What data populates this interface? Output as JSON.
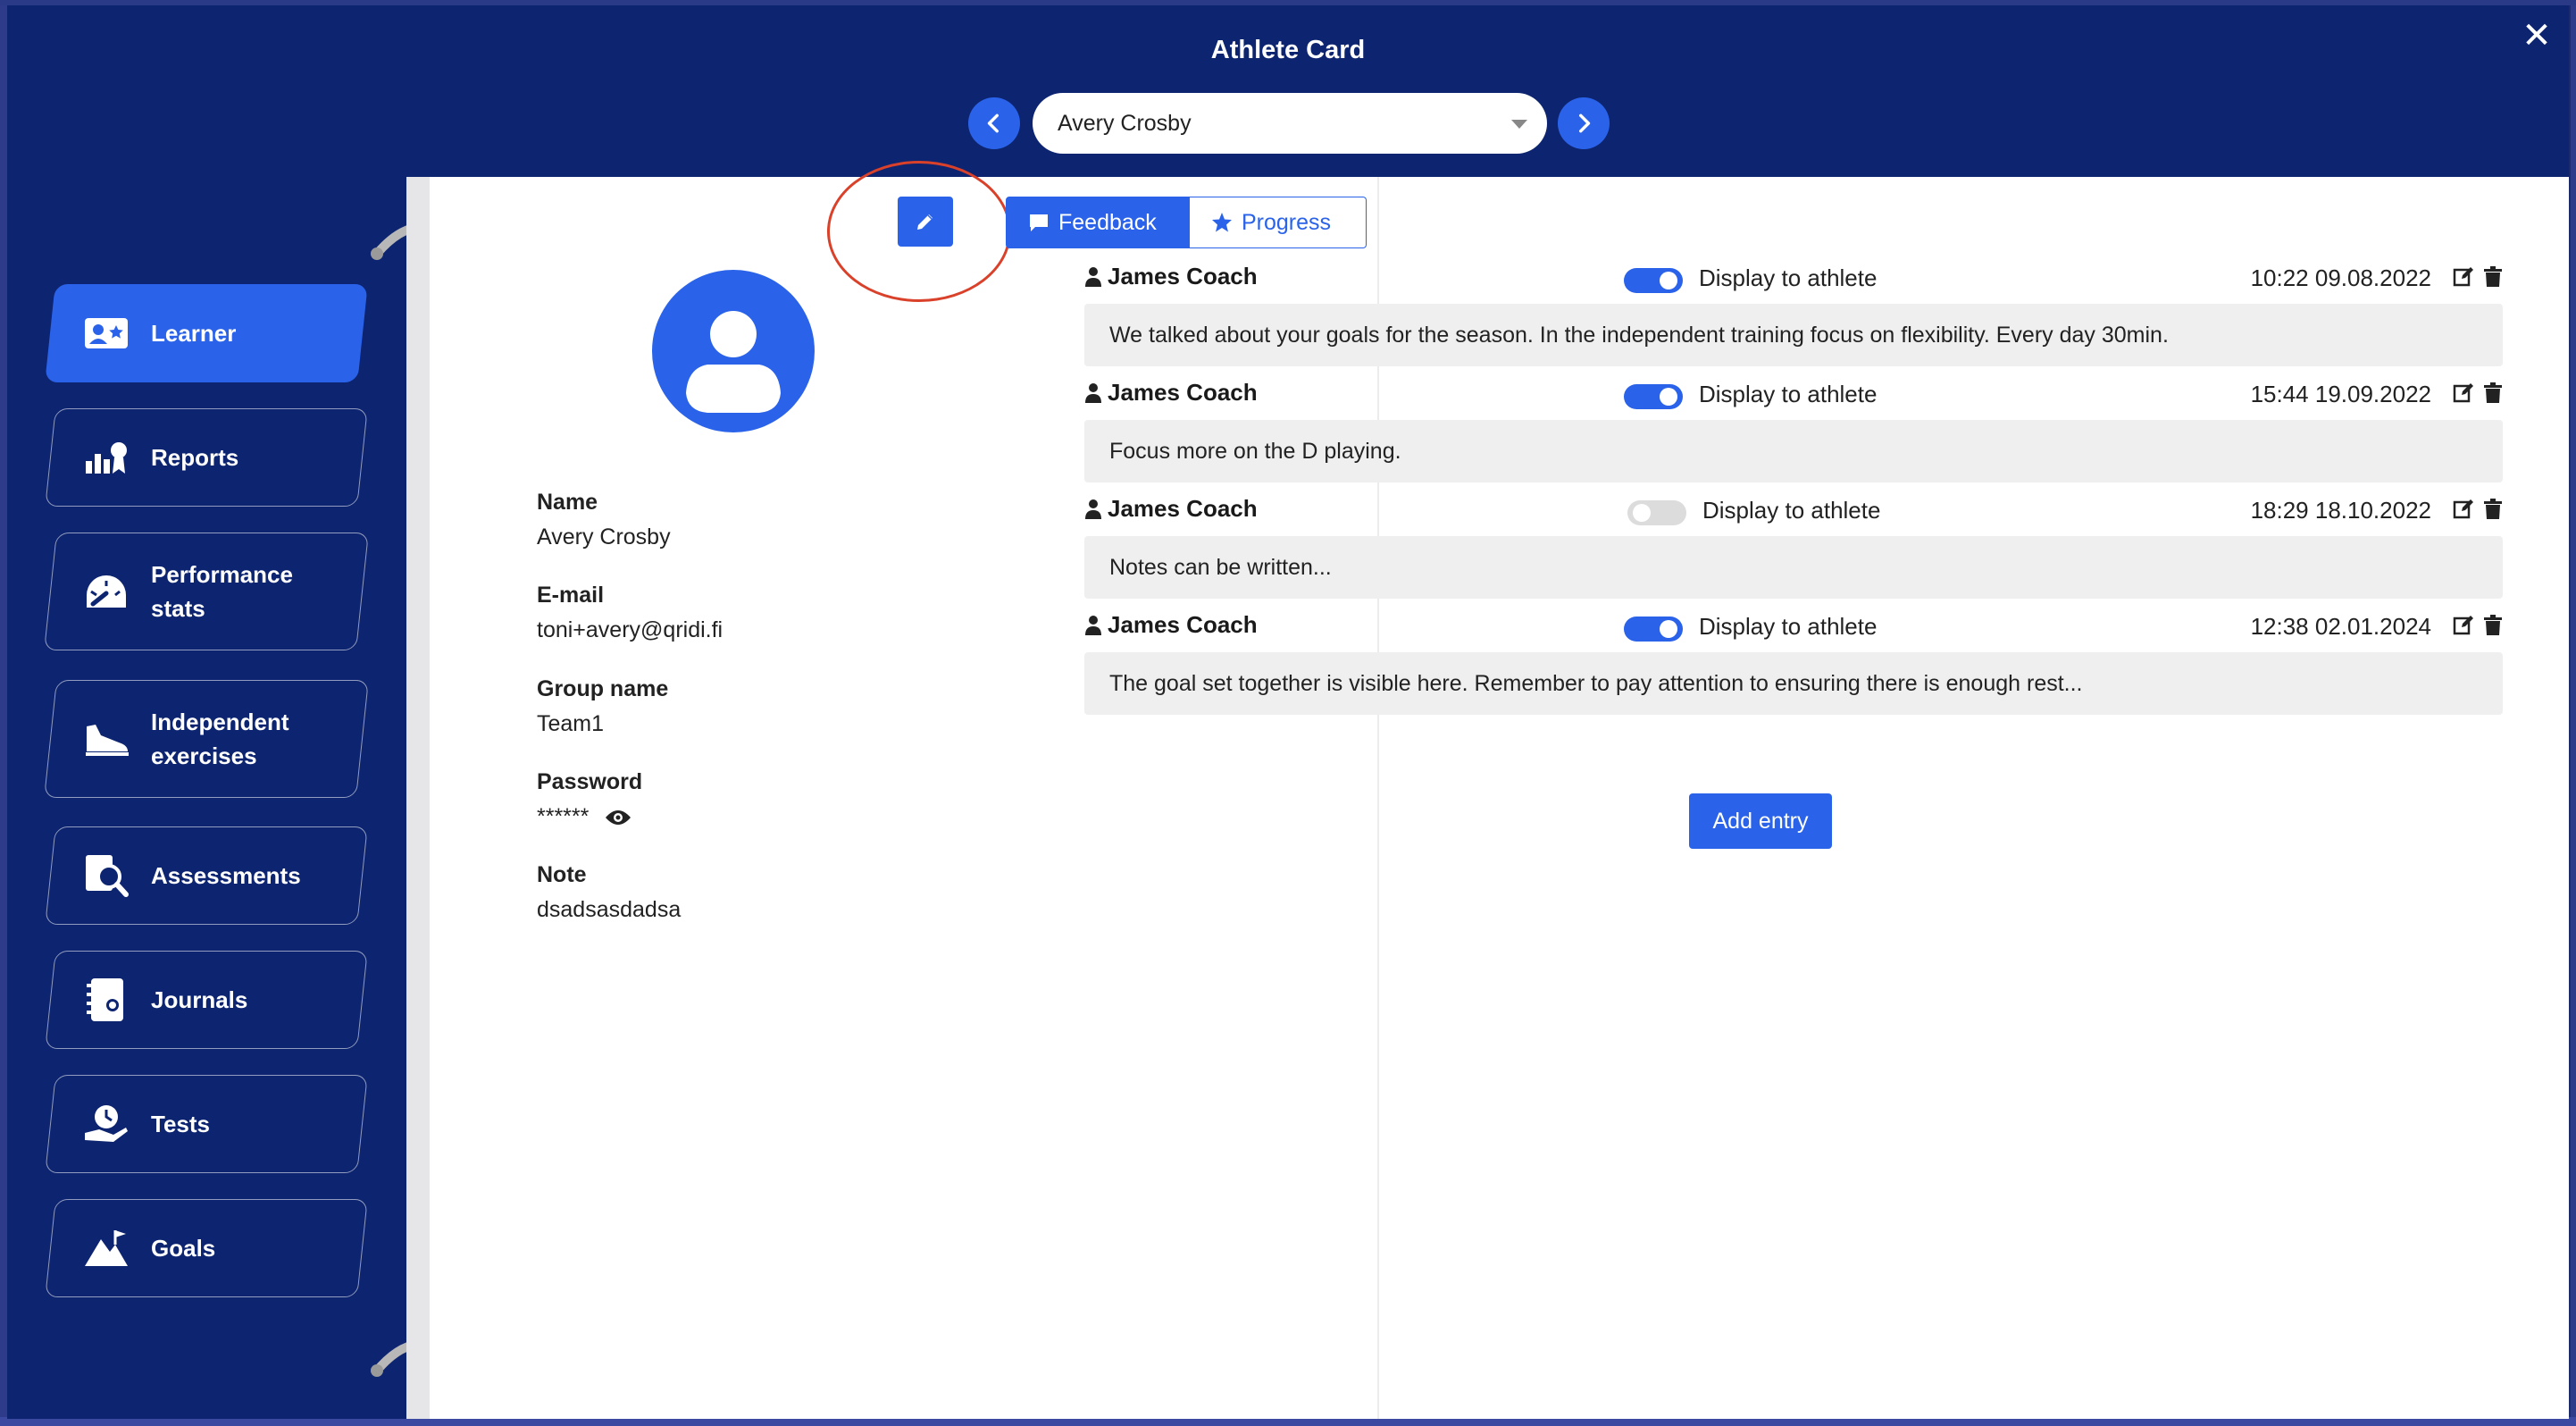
{
  "window": {
    "title": "Athlete Card",
    "close_glyph": "✕"
  },
  "athlete_selector": {
    "selected": "Avery Crosby"
  },
  "colors": {
    "primary": "#2a63ea",
    "navy": "#0d2470",
    "highlight_ring": "#d9412a"
  },
  "sidebar": {
    "items": [
      {
        "label": "Learner",
        "icon": "learner-card-icon",
        "active": true
      },
      {
        "label": "Reports",
        "icon": "reports-chart-icon",
        "active": false
      },
      {
        "label": "Performance stats",
        "icon": "gauge-icon",
        "active": false
      },
      {
        "label": "Independent exercises",
        "icon": "shoe-icon",
        "active": false
      },
      {
        "label": "Assessments",
        "icon": "magnifier-icon",
        "active": false
      },
      {
        "label": "Journals",
        "icon": "journal-icon",
        "active": false
      },
      {
        "label": "Tests",
        "icon": "stopwatch-hand-icon",
        "active": false
      },
      {
        "label": "Goals",
        "icon": "mountain-flag-icon",
        "active": false
      }
    ]
  },
  "profile": {
    "fields": [
      {
        "label": "Name",
        "value": "Avery Crosby"
      },
      {
        "label": "E-mail",
        "value": "toni+avery@qridi.fi"
      },
      {
        "label": "Group name",
        "value": "Team1"
      },
      {
        "label": "Password",
        "value": "******"
      },
      {
        "label": "Note",
        "value": "dsadsasdadsa"
      }
    ]
  },
  "tabs": [
    {
      "label": "Feedback",
      "icon": "comment-icon",
      "active": true
    },
    {
      "label": "Progress",
      "icon": "star-icon",
      "active": false
    }
  ],
  "feedback": {
    "entries": [
      {
        "author": "James Coach",
        "display_on": true,
        "display_label": "Display to athlete",
        "timestamp": "10:22 09.08.2022",
        "text": "We talked about your goals for the season. In the independent training focus on flexibility. Every day 30min."
      },
      {
        "author": "James Coach",
        "display_on": true,
        "display_label": "Display to athlete",
        "timestamp": "15:44 19.09.2022",
        "text": "Focus more on the D playing."
      },
      {
        "author": "James Coach",
        "display_on": false,
        "display_label": "Display to athlete",
        "timestamp": "18:29 18.10.2022",
        "text": "Notes can be written..."
      },
      {
        "author": "James Coach",
        "display_on": true,
        "display_label": "Display to athlete",
        "timestamp": "12:38 02.01.2024",
        "text": "The goal set together is visible here. Remember to pay attention to ensuring there is enough rest..."
      }
    ],
    "add_label": "Add entry"
  }
}
